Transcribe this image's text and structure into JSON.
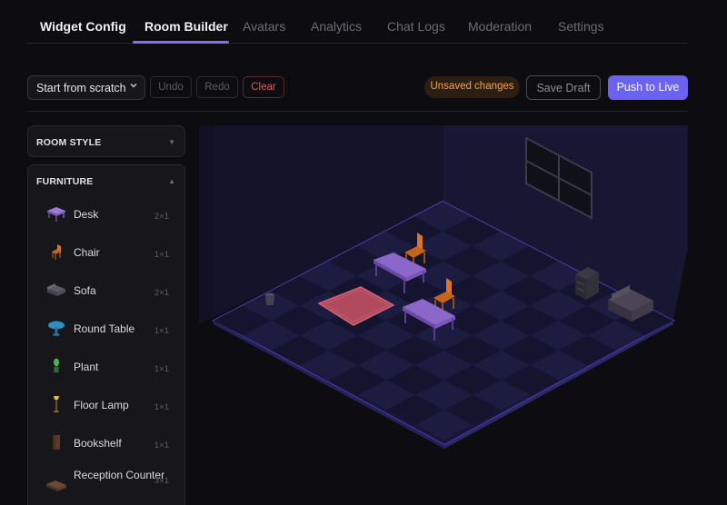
{
  "tabs": [
    {
      "label": "Widget Config"
    },
    {
      "label": "Room Builder"
    },
    {
      "label": "Avatars"
    },
    {
      "label": "Analytics"
    },
    {
      "label": "Chat Logs"
    },
    {
      "label": "Moderation"
    },
    {
      "label": "Settings"
    }
  ],
  "toolbar": {
    "template_select": "Start from scratch",
    "undo": "Undo",
    "redo": "Redo",
    "clear": "Clear",
    "status": "Unsaved changes",
    "save_draft": "Save Draft",
    "push_live": "Push to Live"
  },
  "sidebar": {
    "room_style": {
      "title": "ROOM STYLE",
      "caret": "▼"
    },
    "furniture": {
      "title": "FURNITURE",
      "caret": "▲",
      "items": [
        {
          "label": "Desk",
          "size": "2×1",
          "icon": "desk-icon"
        },
        {
          "label": "Chair",
          "size": "1×1",
          "icon": "chair-icon"
        },
        {
          "label": "Sofa",
          "size": "2×1",
          "icon": "sofa-icon"
        },
        {
          "label": "Round Table",
          "size": "1×1",
          "icon": "round-table-icon"
        },
        {
          "label": "Plant",
          "size": "1×1",
          "icon": "plant-icon"
        },
        {
          "label": "Floor Lamp",
          "size": "1×1",
          "icon": "floor-lamp-icon"
        },
        {
          "label": "Bookshelf",
          "size": "1×1",
          "icon": "bookshelf-icon"
        },
        {
          "label": "Reception Counter",
          "size": "3×1",
          "icon": "reception-counter-icon"
        }
      ]
    }
  },
  "colors": {
    "accent": "#6b63f0",
    "danger": "#e0575d",
    "warning": "#f0a14a",
    "desk": "#8b67c9",
    "chair": "#c4651d",
    "rug": "#b24a5e"
  }
}
